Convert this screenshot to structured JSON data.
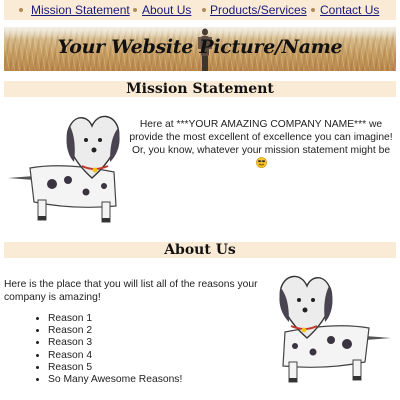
{
  "nav": {
    "items": [
      {
        "label": "Mission Statement"
      },
      {
        "label": "About Us"
      },
      {
        "label": "Products/Services"
      },
      {
        "label": "Contact Us"
      }
    ]
  },
  "banner": {
    "title": "Your Website Picture/Name"
  },
  "mission": {
    "heading": "Mission Statement",
    "text": "Here at ***YOUR AMAZING COMPANY NAME*** we provide the most excellent of excellence you can imagine! Or, you know, whatever your mission statement might be"
  },
  "about": {
    "heading": "About Us",
    "intro": "Here is the place that you will list all of the reasons your company is amazing!",
    "reasons": [
      "Reason 1",
      "Reason 2",
      "Reason 3",
      "Reason 4",
      "Reason 5",
      "So Many Awesome Reasons!"
    ]
  },
  "colors": {
    "section_bar": "#faebd7",
    "link": "#1a1a7a",
    "banner_field": "#c89e62"
  },
  "icons": [
    "smiley-icon",
    "nav-bullet-icon"
  ]
}
